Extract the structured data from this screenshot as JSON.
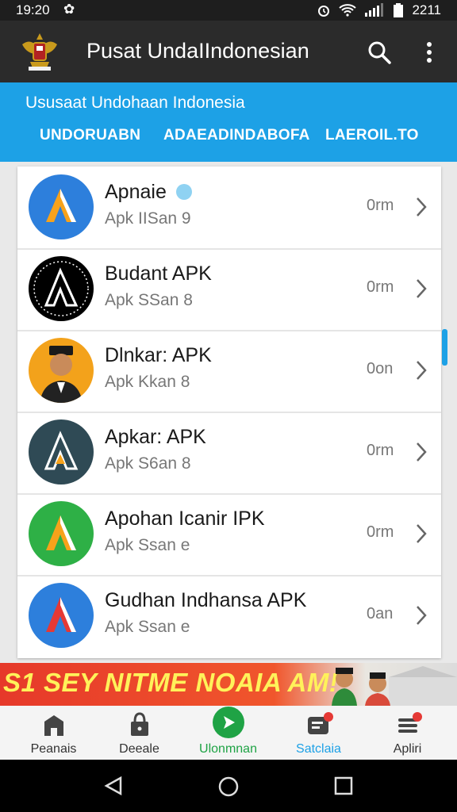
{
  "status_bar": {
    "time": "19:20",
    "right_text": "2211",
    "icons": [
      "settings-icon",
      "alarm-icon",
      "wifi-icon",
      "signal-icon",
      "battery-icon"
    ]
  },
  "app_bar": {
    "title": "Pusat UndaIIndonesian",
    "logo": "garuda-emblem",
    "actions": [
      "search-icon",
      "more-vert-icon"
    ]
  },
  "sub_header": {
    "subtitle": "Ususaat Undohaan Indonesia",
    "tabs": [
      {
        "label": "UNDORUABN"
      },
      {
        "label": "ADAEADINDABOFA"
      },
      {
        "label": "LAEROIL.TO"
      }
    ],
    "color": "#1da1e6"
  },
  "apps": [
    {
      "name": "Apnaie",
      "sub": "Apk IISan 9",
      "size": "0rm",
      "icon": "apk-logo-orange",
      "bg": "#2d7fdc",
      "badge": true
    },
    {
      "name": "Budant APK",
      "sub": "Apk SSan 8",
      "size": "0rm",
      "icon": "apk-logo-white",
      "bg": "#000000",
      "badge": false
    },
    {
      "name": "Dlnkar: APK",
      "sub": "Apk Kkan 8",
      "size": "0on",
      "icon": "person-portrait",
      "bg": "#f3a21b",
      "badge": false
    },
    {
      "name": "Apkar: APK",
      "sub": "Apk S6an 8",
      "size": "0rm",
      "icon": "apk-logo-gray",
      "bg": "#2f4a55",
      "badge": false
    },
    {
      "name": "Apohan Icanir IPK",
      "sub": "Apk Ssan e",
      "size": "0rm",
      "icon": "apk-logo-orange",
      "bg": "#2eb046",
      "badge": false
    },
    {
      "name": "Gudhan Indhansa APK",
      "sub": "Apk Ssan e",
      "size": "0an",
      "icon": "apk-logo-red",
      "bg": "#2d7fdc",
      "badge": false
    }
  ],
  "banner": {
    "text": "S1 SEY NITME NOAIA AM!"
  },
  "bottom_nav": [
    {
      "label": "Peanais",
      "icon": "home-icon",
      "active": false
    },
    {
      "label": "Deeale",
      "icon": "lock-bag-icon",
      "active": false
    },
    {
      "label": "Ulonmnan",
      "icon": "play-arrow-icon",
      "active": true
    },
    {
      "label": "Satclaia",
      "icon": "chat-icon",
      "active": false
    },
    {
      "label": "Apliri",
      "icon": "menu-stack-icon",
      "active": false
    }
  ],
  "colors": {
    "accent": "#1da1e6",
    "active_nav": "#1fa345",
    "badge": "#e53935"
  }
}
